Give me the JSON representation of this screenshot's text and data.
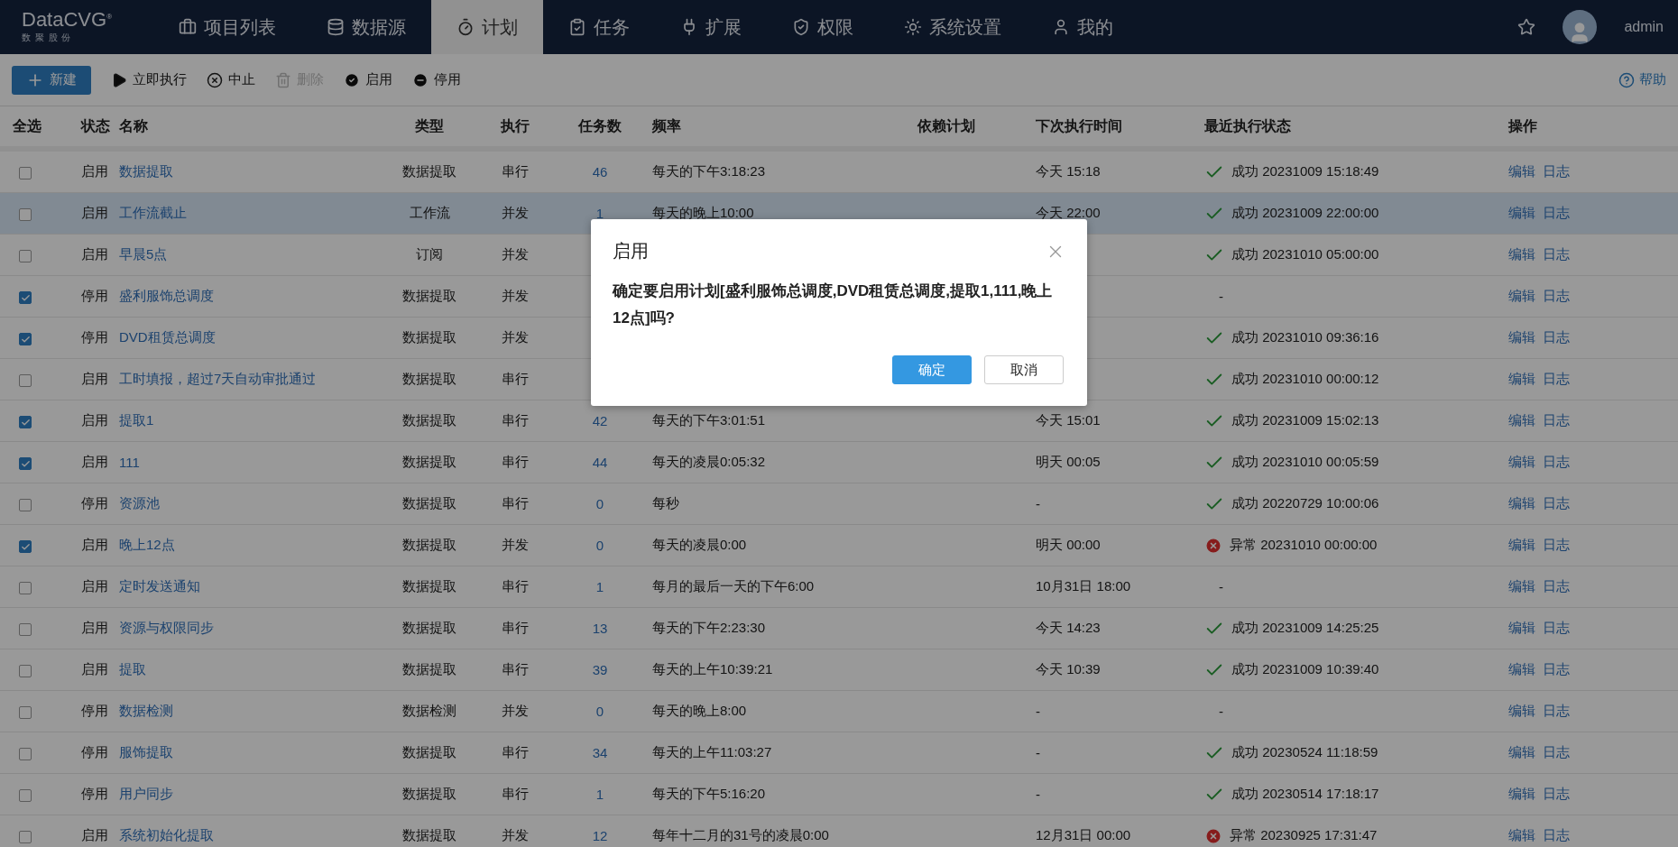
{
  "logo": {
    "name": "DataCVG",
    "mark": "®",
    "subtitle": "数 聚 股 份"
  },
  "nav": [
    {
      "label": "项目列表",
      "selected": false
    },
    {
      "label": "数据源",
      "selected": false
    },
    {
      "label": "计划",
      "selected": true
    },
    {
      "label": "任务",
      "selected": false
    },
    {
      "label": "扩展",
      "selected": false
    },
    {
      "label": "权限",
      "selected": false
    },
    {
      "label": "系统设置",
      "selected": false
    },
    {
      "label": "我的",
      "selected": false
    }
  ],
  "user": {
    "name": "admin"
  },
  "toolbar": [
    {
      "kind": "primary",
      "label": "新建",
      "disabled": false
    },
    {
      "kind": "plain",
      "label": "立即执行",
      "disabled": false
    },
    {
      "kind": "plain",
      "label": "中止",
      "disabled": false
    },
    {
      "kind": "plain",
      "label": "删除",
      "disabled": true
    },
    {
      "kind": "plain",
      "label": "启用",
      "disabled": false
    },
    {
      "kind": "plain",
      "label": "停用",
      "disabled": false
    }
  ],
  "help": "帮助",
  "columns": [
    "全选",
    "状态",
    "名称",
    "类型",
    "执行",
    "任务数",
    "频率",
    "依赖计划",
    "下次执行时间",
    "最近执行状态",
    "操作"
  ],
  "rows": [
    {
      "checked": false,
      "selected": false,
      "status": "启用",
      "name": "数据提取",
      "type": "数据提取",
      "mode": "串行",
      "tasks": "46",
      "freq": "每天的下午3:18:23",
      "next": "今天 15:18",
      "result": {
        "kind": "success",
        "text": "成功 20231009 15:18:49"
      },
      "actions": [
        "编辑",
        "日志"
      ]
    },
    {
      "checked": false,
      "selected": true,
      "status": "启用",
      "name": "工作流截止",
      "type": "工作流",
      "mode": "并发",
      "tasks": "1",
      "freq": "每天的晚上10:00",
      "next": "今天 22:00",
      "result": {
        "kind": "success",
        "text": "成功 20231009 22:00:00"
      },
      "actions": [
        "编辑",
        "日志"
      ]
    },
    {
      "checked": false,
      "selected": false,
      "status": "启用",
      "name": "早晨5点",
      "type": "订阅",
      "mode": "并发",
      "result": {
        "kind": "success",
        "text": "成功 20231010 05:00:00"
      },
      "actions": [
        "编辑",
        "日志"
      ]
    },
    {
      "checked": true,
      "selected": false,
      "status": "停用",
      "name": "盛利服饰总调度",
      "type": "数据提取",
      "mode": "并发",
      "result": {
        "kind": "none",
        "text": "-"
      },
      "actions": [
        "编辑",
        "日志"
      ]
    },
    {
      "checked": true,
      "selected": false,
      "status": "停用",
      "name": "DVD租赁总调度",
      "type": "数据提取",
      "mode": "并发",
      "result": {
        "kind": "success",
        "text": "成功 20231010 09:36:16"
      },
      "actions": [
        "编辑",
        "日志"
      ]
    },
    {
      "checked": false,
      "selected": false,
      "status": "启用",
      "name": "工时填报，超过7天自动审批通过",
      "type": "数据提取",
      "mode": "串行",
      "result": {
        "kind": "success",
        "text": "成功 20231010 00:00:12"
      },
      "actions": [
        "编辑",
        "日志"
      ]
    },
    {
      "checked": true,
      "selected": false,
      "status": "启用",
      "name": "提取1",
      "type": "数据提取",
      "mode": "串行",
      "tasks": "42",
      "freq": "每天的下午3:01:51",
      "next": "今天 15:01",
      "result": {
        "kind": "success",
        "text": "成功 20231009 15:02:13"
      },
      "actions": [
        "编辑",
        "日志"
      ]
    },
    {
      "checked": true,
      "selected": false,
      "status": "启用",
      "name": "111",
      "type": "数据提取",
      "mode": "串行",
      "tasks": "44",
      "freq": "每天的凌晨0:05:32",
      "next": "明天 00:05",
      "result": {
        "kind": "success",
        "text": "成功 20231010 00:05:59"
      },
      "actions": [
        "编辑",
        "日志"
      ]
    },
    {
      "checked": false,
      "selected": false,
      "status": "停用",
      "name": "资源池",
      "type": "数据提取",
      "mode": "串行",
      "tasks": "0",
      "freq": "每秒",
      "next": "-",
      "result": {
        "kind": "success",
        "text": "成功 20220729 10:00:06"
      },
      "actions": [
        "编辑",
        "日志"
      ]
    },
    {
      "checked": true,
      "selected": false,
      "status": "启用",
      "name": "晚上12点",
      "type": "数据提取",
      "mode": "并发",
      "tasks": "0",
      "freq": "每天的凌晨0:00",
      "next": "明天 00:00",
      "result": {
        "kind": "error",
        "text": "异常 20231010 00:00:00"
      },
      "actions": [
        "编辑",
        "日志"
      ]
    },
    {
      "checked": false,
      "selected": false,
      "status": "启用",
      "name": "定时发送通知",
      "type": "数据提取",
      "mode": "串行",
      "tasks": "1",
      "freq": "每月的最后一天的下午6:00",
      "next": "10月31日 18:00",
      "result": {
        "kind": "none",
        "text": "-"
      },
      "actions": [
        "编辑",
        "日志"
      ]
    },
    {
      "checked": false,
      "selected": false,
      "status": "启用",
      "name": "资源与权限同步",
      "type": "数据提取",
      "mode": "串行",
      "tasks": "13",
      "freq": "每天的下午2:23:30",
      "next": "今天 14:23",
      "result": {
        "kind": "success",
        "text": "成功 20231009 14:25:25"
      },
      "actions": [
        "编辑",
        "日志"
      ]
    },
    {
      "checked": false,
      "selected": false,
      "status": "启用",
      "name": "提取",
      "type": "数据提取",
      "mode": "串行",
      "tasks": "39",
      "freq": "每天的上午10:39:21",
      "next": "今天 10:39",
      "result": {
        "kind": "success",
        "text": "成功 20231009 10:39:40"
      },
      "actions": [
        "编辑",
        "日志"
      ]
    },
    {
      "checked": false,
      "selected": false,
      "status": "停用",
      "name": "数据检测",
      "type": "数据检测",
      "mode": "并发",
      "tasks": "0",
      "freq": "每天的晚上8:00",
      "next": "-",
      "result": {
        "kind": "none",
        "text": "-"
      },
      "actions": [
        "编辑",
        "日志"
      ]
    },
    {
      "checked": false,
      "selected": false,
      "status": "停用",
      "name": "服饰提取",
      "type": "数据提取",
      "mode": "串行",
      "tasks": "34",
      "freq": "每天的上午11:03:27",
      "next": "-",
      "result": {
        "kind": "success",
        "text": "成功 20230524 11:18:59"
      },
      "actions": [
        "编辑",
        "日志"
      ]
    },
    {
      "checked": false,
      "selected": false,
      "status": "停用",
      "name": "用户同步",
      "type": "数据提取",
      "mode": "串行",
      "tasks": "1",
      "freq": "每天的下午5:16:20",
      "next": "-",
      "result": {
        "kind": "success",
        "text": "成功 20230514 17:18:17"
      },
      "actions": [
        "编辑",
        "日志"
      ]
    },
    {
      "checked": false,
      "selected": false,
      "status": "启用",
      "name": "系统初始化提取",
      "type": "数据提取",
      "mode": "并发",
      "tasks": "12",
      "freq": "每年十二月的31号的凌晨0:00",
      "next": "12月31日 00:00",
      "result": {
        "kind": "error",
        "text": "异常 20230925 17:31:47"
      },
      "actions": [
        "编辑",
        "日志"
      ]
    }
  ],
  "dialog": {
    "title": "启用",
    "message": "确定要启用计划[盛利服饰总调度,DVD租赁总调度,提取1,111,晚上12点]吗?",
    "confirm": "确定",
    "cancel": "取消"
  }
}
